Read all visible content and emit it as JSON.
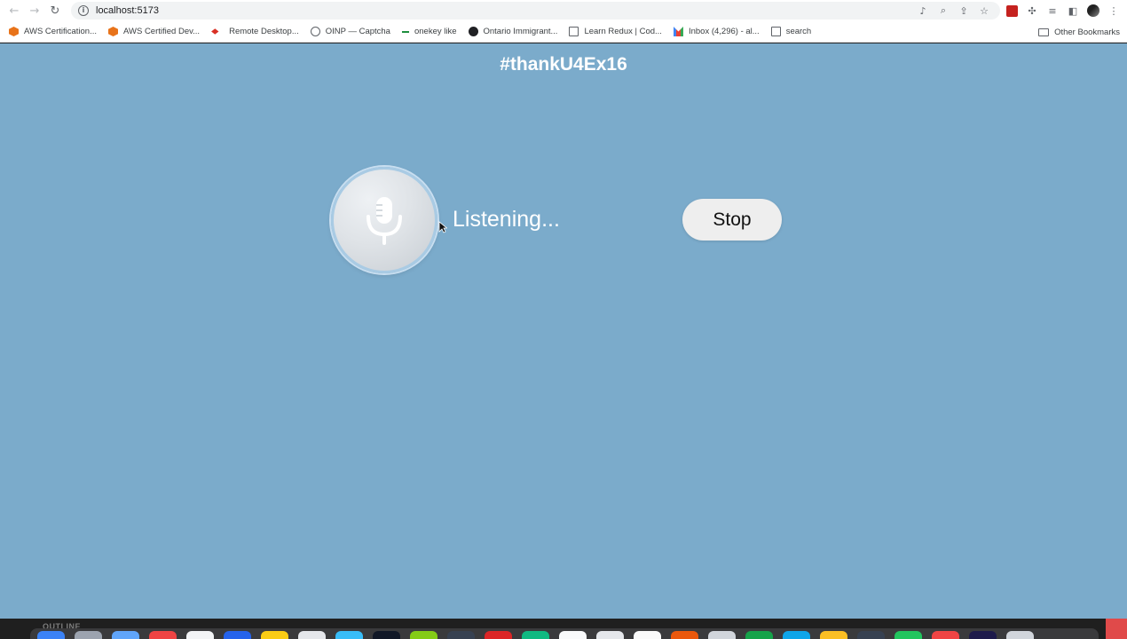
{
  "browser": {
    "url": "localhost:5173",
    "bookmarks": [
      {
        "label": "AWS Certification...",
        "icon": "aws-icon"
      },
      {
        "label": "AWS Certified Dev...",
        "icon": "aws-icon"
      },
      {
        "label": "Remote Desktop...",
        "icon": "remote-desktop-icon"
      },
      {
        "label": "OINP — Captcha",
        "icon": "globe-icon"
      },
      {
        "label": "onekey like",
        "icon": "dash-icon"
      },
      {
        "label": "Ontario Immigrant...",
        "icon": "shield-icon"
      },
      {
        "label": "Learn Redux | Cod...",
        "icon": "doc-icon"
      },
      {
        "label": "Inbox (4,296) - al...",
        "icon": "gmail-icon"
      },
      {
        "label": "search",
        "icon": "page-icon"
      }
    ],
    "other_bookmarks": "Other Bookmarks"
  },
  "app": {
    "title": "#thankU4Ex16",
    "status": "Listening...",
    "stop_label": "Stop",
    "mic_icon": "microphone-icon"
  },
  "os": {
    "outline_label": "OUTLINE",
    "dock_colors": [
      "#3b82f6",
      "#9ca3af",
      "#60a5fa",
      "#ef4444",
      "#f3f4f6",
      "#2563eb",
      "#facc15",
      "#e5e7eb",
      "#38bdf8",
      "#111827",
      "#84cc16",
      "#374151",
      "#dc2626",
      "#10b981",
      "#f9fafb",
      "#e5e7eb",
      "#fafafa",
      "#ea580c",
      "#d1d5db",
      "#16a34a",
      "#0ea5e9",
      "#fbbf24",
      "#374151",
      "#22c55e",
      "#ef4444",
      "#1e1b4b",
      "#d1d5db"
    ]
  },
  "colors": {
    "page_background": "#7babcb",
    "text": "#ffffff",
    "stop_button": "#eeeeee"
  }
}
